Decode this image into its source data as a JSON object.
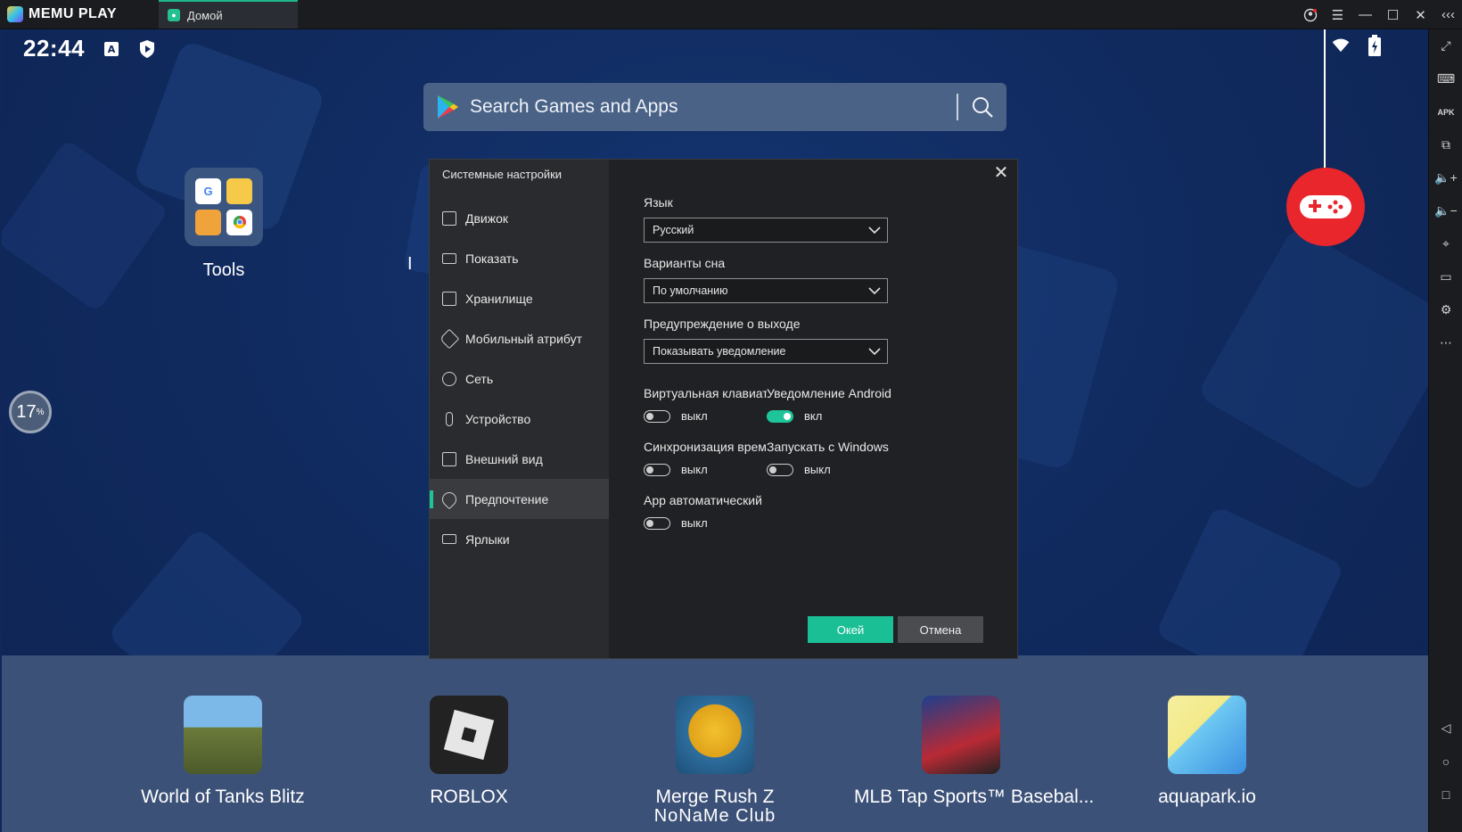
{
  "app": {
    "brand": "MEMU PLAY",
    "tab_label": "Домой"
  },
  "status": {
    "time": "22:44",
    "performance_percent": "17",
    "percent_sign": "%"
  },
  "search": {
    "placeholder": "Search Games and Apps"
  },
  "desktop": {
    "folder_label": "Tools",
    "partial_letter": "I"
  },
  "dock": {
    "apps": [
      {
        "label": "World of Tanks Blitz"
      },
      {
        "label": "ROBLOX"
      },
      {
        "label": "Merge Rush Z",
        "sub": "NoNaMe Club"
      },
      {
        "label": "MLB Tap Sports™ Basebal..."
      },
      {
        "label": "aquapark.io"
      }
    ]
  },
  "dialog": {
    "title": "Системные настройки",
    "menu": [
      {
        "label": "Движок",
        "icon": "chip-icon"
      },
      {
        "label": "Показать",
        "icon": "monitor-icon"
      },
      {
        "label": "Хранилище",
        "icon": "storage-icon"
      },
      {
        "label": "Мобильный атрибут",
        "icon": "tag-icon"
      },
      {
        "label": "Сеть",
        "icon": "globe-icon"
      },
      {
        "label": "Устройство",
        "icon": "microphone-icon"
      },
      {
        "label": "Внешний вид",
        "icon": "window-icon"
      },
      {
        "label": "Предпочтение",
        "icon": "wrench-icon",
        "active": true
      },
      {
        "label": "Ярлыки",
        "icon": "keyboard-icon"
      }
    ],
    "language": {
      "label": "Язык",
      "value": "Русский"
    },
    "sleep": {
      "label": "Варианты сна",
      "value": "По умолчанию"
    },
    "exit_warning": {
      "label": "Предупреждение о выходе",
      "value": "Показывать уведомление"
    },
    "toggles": {
      "virtual_keyboard": {
        "label": "Виртуальная клавиат",
        "state": "выкл",
        "on": false
      },
      "android_notify": {
        "label": "Уведомление Android",
        "state": "вкл",
        "on": true
      },
      "time_sync": {
        "label": "Синхронизация време",
        "state": "выкл",
        "on": false
      },
      "start_windows": {
        "label": "Запускать с Windows",
        "state": "выкл",
        "on": false
      },
      "app_auto": {
        "label": "App автоматический",
        "state": "выкл",
        "on": false
      }
    },
    "ok_label": "Окей",
    "cancel_label": "Отмена"
  },
  "colors": {
    "accent": "#1fc59a",
    "gamepad": "#e8262c",
    "dock": "#3c5178"
  }
}
